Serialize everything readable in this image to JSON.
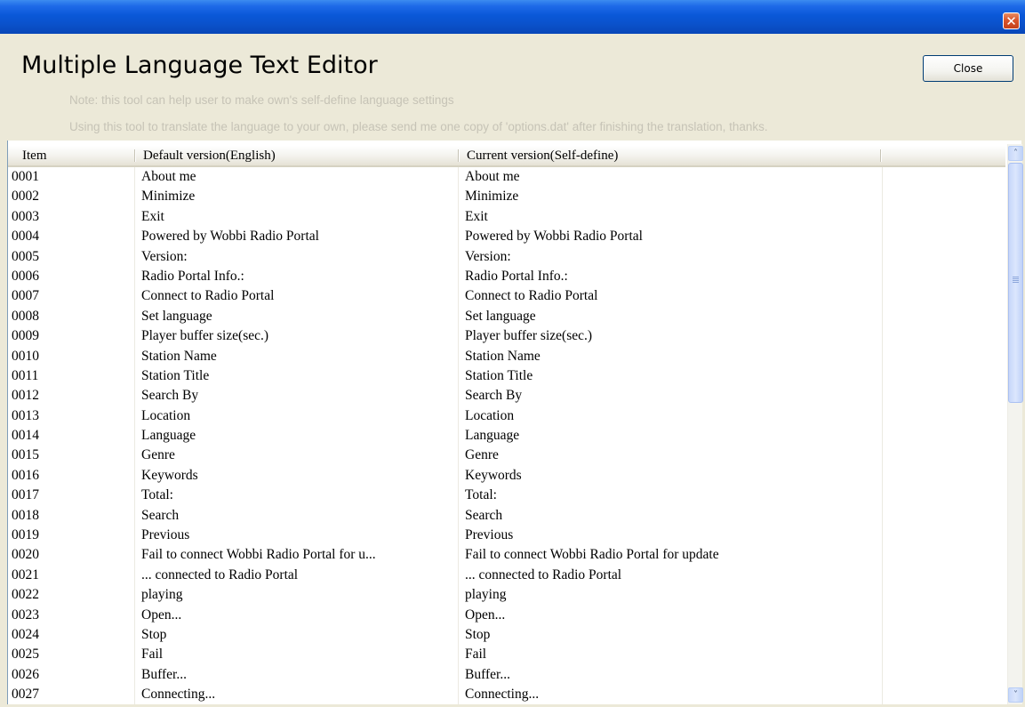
{
  "window": {
    "title": "",
    "close_glyph": "✕"
  },
  "header": {
    "title": "Multiple Language Text Editor",
    "close_label": "Close",
    "note_line1": "Note: this tool can help user to make own's self-define language settings",
    "note_line2": "Using this tool to translate the language to your own, please send me one copy of 'options.dat' after finishing the translation, thanks."
  },
  "table": {
    "columns": [
      "Item",
      "Default version(English)",
      "Current version(Self-define)",
      ""
    ],
    "rows": [
      {
        "item": "0001",
        "default": "About me",
        "current": "About me"
      },
      {
        "item": "0002",
        "default": "Minimize",
        "current": "Minimize"
      },
      {
        "item": "0003",
        "default": "Exit",
        "current": "Exit"
      },
      {
        "item": "0004",
        "default": "Powered by Wobbi Radio Portal",
        "current": "Powered by Wobbi Radio Portal"
      },
      {
        "item": "0005",
        "default": "Version:",
        "current": "Version:"
      },
      {
        "item": "0006",
        "default": "Radio Portal Info.:",
        "current": "Radio Portal Info.:"
      },
      {
        "item": "0007",
        "default": "Connect to Radio Portal",
        "current": "Connect to Radio Portal"
      },
      {
        "item": "0008",
        "default": "Set language",
        "current": "Set language"
      },
      {
        "item": "0009",
        "default": "Player buffer size(sec.)",
        "current": "Player buffer size(sec.)"
      },
      {
        "item": "0010",
        "default": "Station Name",
        "current": "Station Name"
      },
      {
        "item": "0011",
        "default": "Station Title",
        "current": "Station Title"
      },
      {
        "item": "0012",
        "default": "Search By",
        "current": "Search By"
      },
      {
        "item": "0013",
        "default": "Location",
        "current": "Location"
      },
      {
        "item": "0014",
        "default": "Language",
        "current": "Language"
      },
      {
        "item": "0015",
        "default": "Genre",
        "current": "Genre"
      },
      {
        "item": "0016",
        "default": "Keywords",
        "current": "Keywords"
      },
      {
        "item": "0017",
        "default": "Total:",
        "current": "Total:"
      },
      {
        "item": "0018",
        "default": "Search",
        "current": "Search"
      },
      {
        "item": "0019",
        "default": "Previous",
        "current": "Previous"
      },
      {
        "item": "0020",
        "default": "Fail to connect Wobbi Radio Portal for u...",
        "current": "Fail to connect Wobbi Radio Portal for update"
      },
      {
        "item": "0021",
        "default": "... connected to Radio Portal",
        "current": "... connected to Radio Portal"
      },
      {
        "item": "0022",
        "default": "playing",
        "current": "playing"
      },
      {
        "item": "0023",
        "default": "Open...",
        "current": "Open..."
      },
      {
        "item": "0024",
        "default": "Stop",
        "current": "Stop"
      },
      {
        "item": "0025",
        "default": "Fail",
        "current": "Fail"
      },
      {
        "item": "0026",
        "default": "Buffer...",
        "current": "Buffer..."
      },
      {
        "item": "0027",
        "default": "Connecting...",
        "current": "Connecting..."
      }
    ]
  },
  "scrollbar": {
    "up_glyph": "˄",
    "down_glyph": "˅"
  },
  "colors": {
    "titlebar": "#0A58D8",
    "window_bg": "#ECE9D8",
    "note_text": "#C6C3B6",
    "close_button_red": "#D9552D"
  }
}
